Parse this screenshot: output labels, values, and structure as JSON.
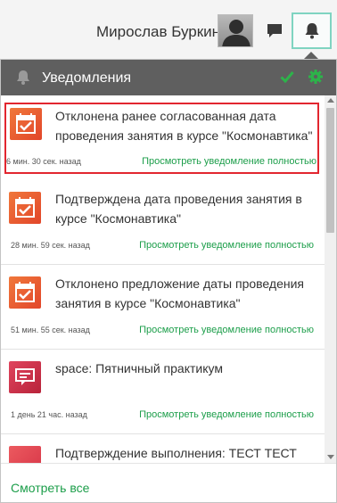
{
  "topbar": {
    "user_name": "Мирослав Буркин",
    "avatar_icon": "user-silhouette-icon",
    "chat_icon": "chat-bubble-icon",
    "bell_icon": "bell-icon",
    "bell_highlight_color": "#7fd4c1"
  },
  "panel": {
    "title": "Уведомления",
    "header_bell_icon": "bell-icon",
    "mark_read_icon": "checkmark-icon",
    "settings_icon": "gear-icon",
    "header_color": "#5f5f5f",
    "accent_color": "#1c9e4a",
    "see_all_label": "Смотреть все"
  },
  "notifications": [
    {
      "title": "Отклонена ранее согласованная дата проведения занятия в курсе \"Космонавтика\"",
      "time": "6 мин. 30 сек. назад",
      "link": "Просмотреть уведомление полностью",
      "icon": "calendar-check-icon",
      "icon_color": "#e9572f",
      "selected": true
    },
    {
      "title": "Подтверждена дата проведения занятия в курсе \"Космонавтика\"",
      "time": "28 мин. 59 сек. назад",
      "link": "Просмотреть уведомление полностью",
      "icon": "calendar-check-icon",
      "icon_color": "#e9572f"
    },
    {
      "title": "Отклонено предложение даты проведения занятия в курсе \"Космонавтика\"",
      "time": "51 мин. 55 сек. назад",
      "link": "Просмотреть уведомление полностью",
      "icon": "calendar-check-icon",
      "icon_color": "#e9572f"
    },
    {
      "title": "space: Пятничный практикум",
      "time": "1 день 21 час. назад",
      "link": "Просмотреть уведомление полностью",
      "icon": "message-board-icon",
      "icon_color": "#c92d47"
    },
    {
      "title": "Подтверждение выполнения: ТЕСТ ТЕСТ",
      "icon": "message-board-icon",
      "icon_color": "#e04452"
    }
  ]
}
